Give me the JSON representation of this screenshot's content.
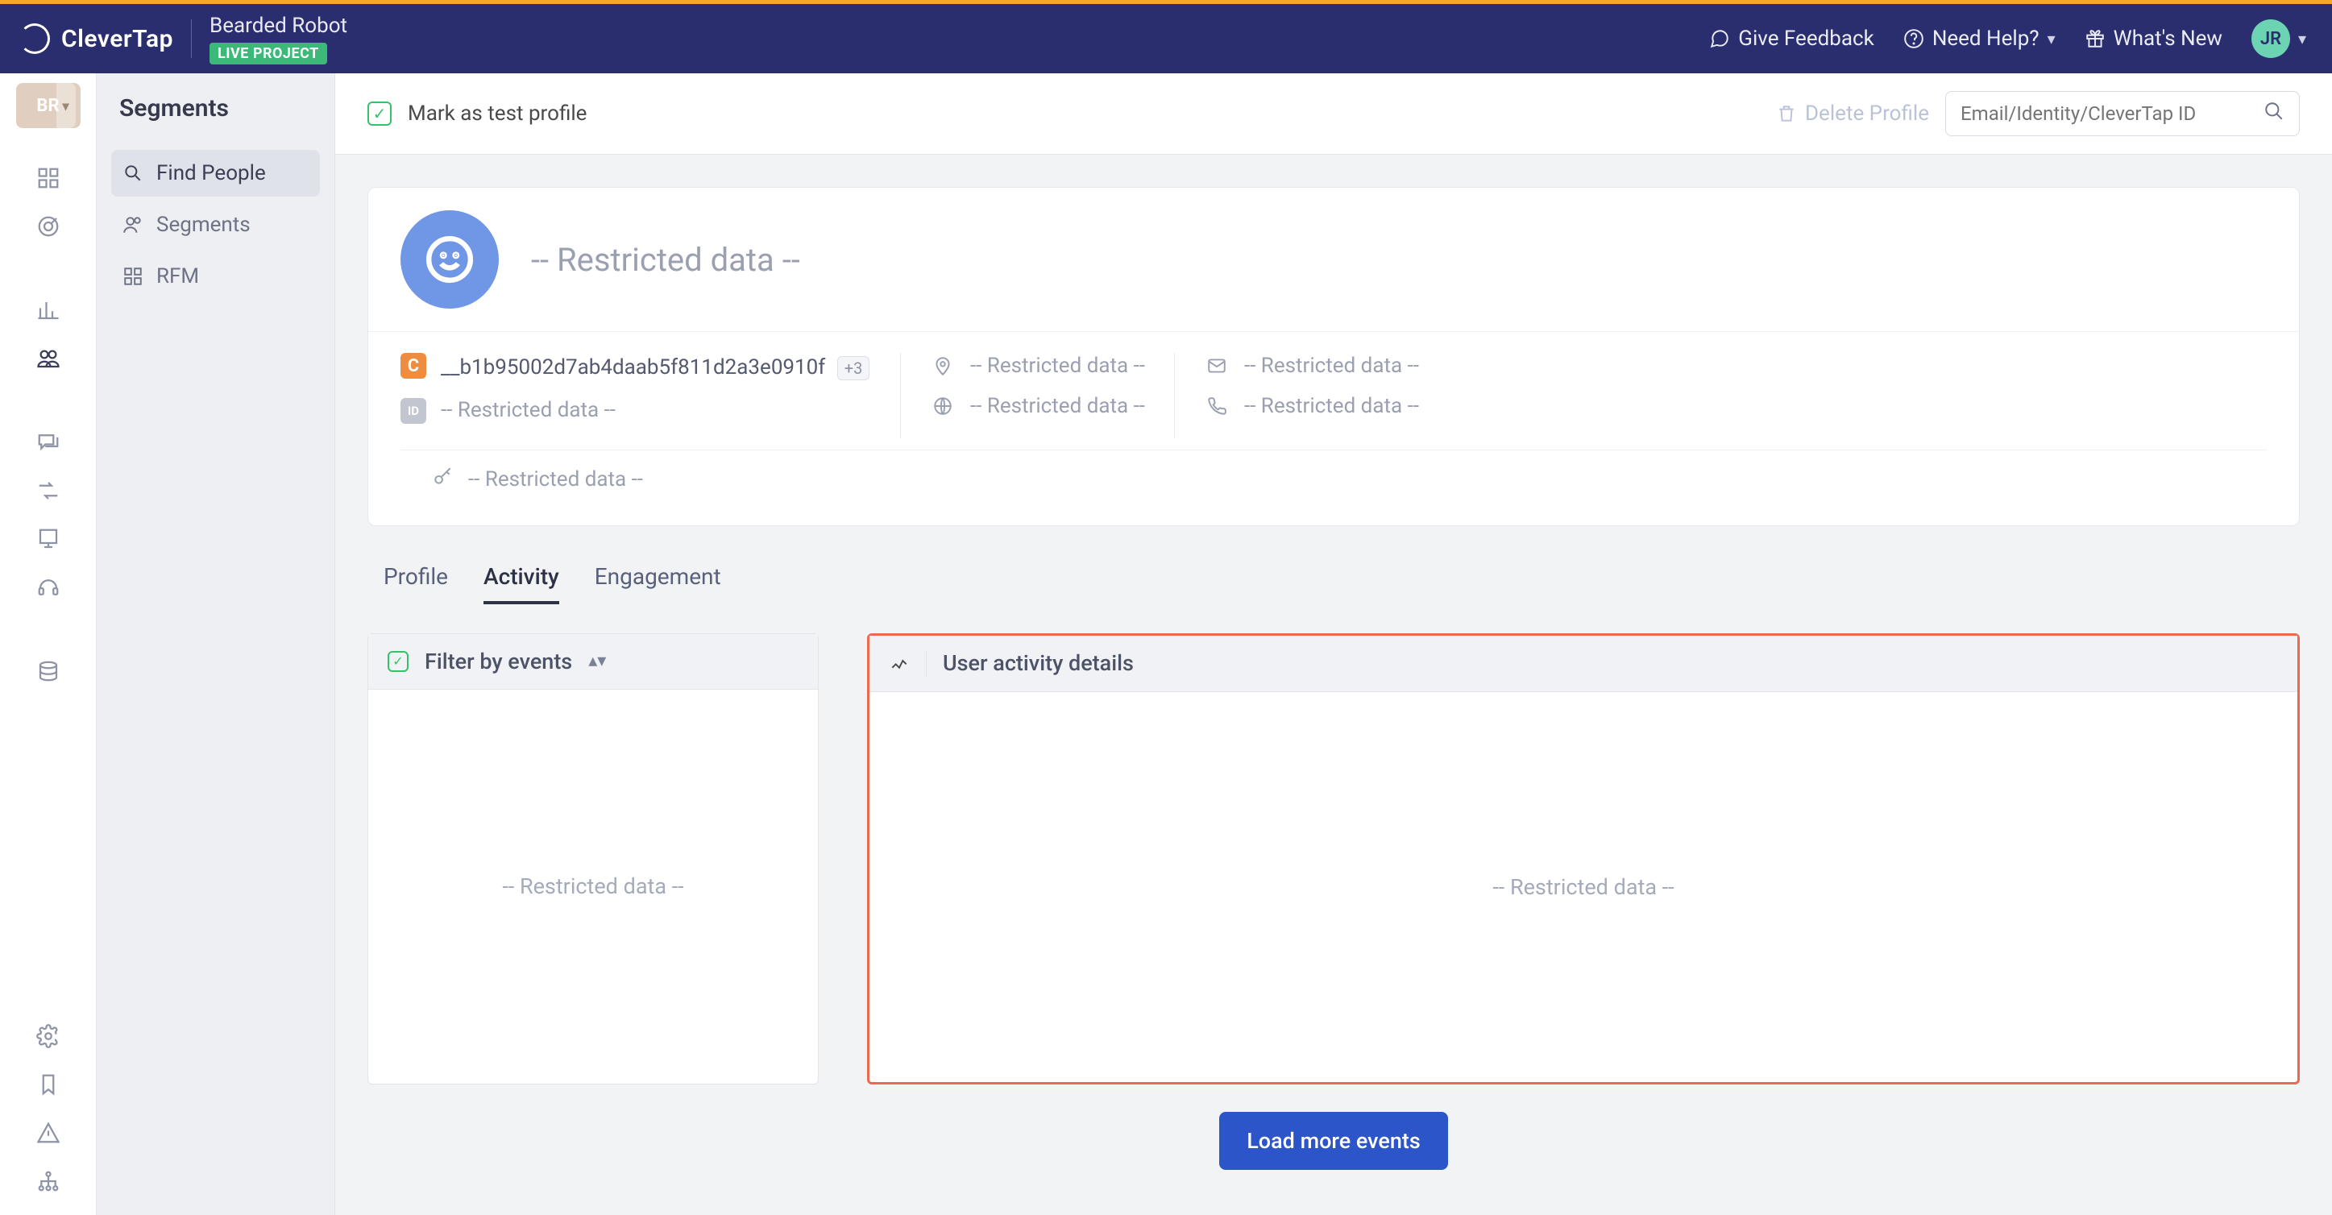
{
  "header": {
    "brand": "CleverTap",
    "project": "Bearded Robot",
    "project_tag": "LIVE PROJECT",
    "feedback": "Give Feedback",
    "help": "Need Help?",
    "whats_new": "What's New",
    "avatar_initials": "JR"
  },
  "rail": {
    "project_chip": "BR"
  },
  "sidebar": {
    "title": "Segments",
    "items": [
      {
        "label": "Find People"
      },
      {
        "label": "Segments"
      },
      {
        "label": "RFM"
      }
    ]
  },
  "toolbar": {
    "mark_test": "Mark as test profile",
    "delete": "Delete Profile",
    "search_placeholder": "Email/Identity/CleverTap ID"
  },
  "profile": {
    "name": "-- Restricted data --",
    "id_value": "__b1b95002d7ab4daab5f811d2a3e0910f",
    "plus_badge": "+3",
    "restricted": "-- Restricted data --"
  },
  "tabs": {
    "profile": "Profile",
    "activity": "Activity",
    "engagement": "Engagement"
  },
  "filter_panel": {
    "title": "Filter by events",
    "body": "-- Restricted data --"
  },
  "activity_panel": {
    "title": "User activity details",
    "body": "-- Restricted data --"
  },
  "load_more": "Load more events"
}
